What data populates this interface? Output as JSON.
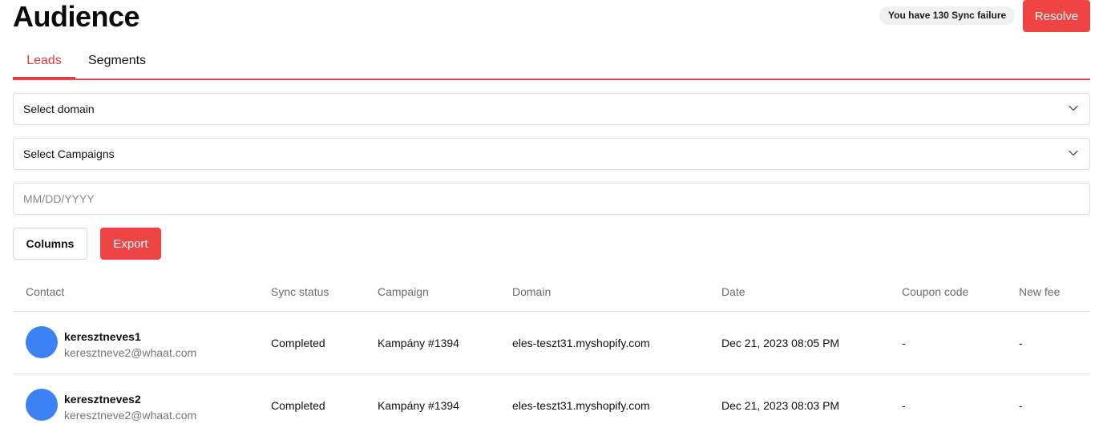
{
  "header": {
    "title": "Audience",
    "sync_failure_text": "You have 130 Sync failure",
    "resolve_label": "Resolve"
  },
  "tabs": [
    {
      "label": "Leads",
      "active": true
    },
    {
      "label": "Segments",
      "active": false
    }
  ],
  "filters": {
    "domain_select": {
      "value": "Select domain"
    },
    "campaign_select": {
      "value": "Select Campaigns"
    },
    "date_input": {
      "placeholder": "MM/DD/YYYY",
      "value": ""
    }
  },
  "actions": {
    "columns_label": "Columns",
    "export_label": "Export"
  },
  "table": {
    "columns": [
      "Contact",
      "Sync status",
      "Campaign",
      "Domain",
      "Date",
      "Coupon code",
      "New fee"
    ],
    "rows": [
      {
        "name": "keresztneves1",
        "email": "keresztneve2@whaat.com",
        "sync_status": "Completed",
        "campaign": "Kampány #1394",
        "domain": "eles-teszt31.myshopify.com",
        "date": "Dec 21, 2023 08:05 PM",
        "coupon_code": "-",
        "new_fee": "-"
      },
      {
        "name": "keresztneves2",
        "email": "keresztneve2@whaat.com",
        "sync_status": "Completed",
        "campaign": "Kampány #1394",
        "domain": "eles-teszt31.myshopify.com",
        "date": "Dec 21, 2023 08:03 PM",
        "coupon_code": "-",
        "new_fee": "-"
      }
    ]
  },
  "colors": {
    "accent": "#ee4444",
    "avatar": "#3b82f6",
    "tab_active": "#e03a3e"
  },
  "icons": {
    "select_chevron": "chevron-down-icon"
  }
}
